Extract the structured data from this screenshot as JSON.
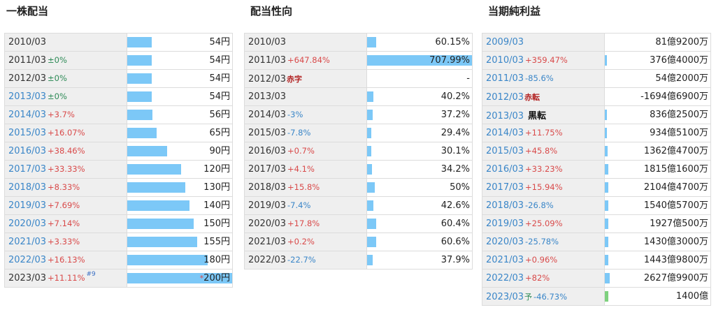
{
  "dividend": {
    "title": "一株配当",
    "rows": [
      {
        "year": "2010/03",
        "change": "",
        "chg_color": "",
        "value": "54円",
        "bar": 0.23,
        "year_blue": false,
        "note": "",
        "star": ""
      },
      {
        "year": "2011/03",
        "change": "±0%",
        "chg_color": "green",
        "value": "54円",
        "bar": 0.23,
        "year_blue": false,
        "note": "",
        "star": ""
      },
      {
        "year": "2012/03",
        "change": "±0%",
        "chg_color": "green",
        "value": "54円",
        "bar": 0.23,
        "year_blue": false,
        "note": "",
        "star": ""
      },
      {
        "year": "2013/03",
        "change": "±0%",
        "chg_color": "green",
        "value": "54円",
        "bar": 0.23,
        "year_blue": true,
        "note": "",
        "star": ""
      },
      {
        "year": "2014/03",
        "change": "+3.7%",
        "chg_color": "red",
        "value": "56円",
        "bar": 0.24,
        "year_blue": true,
        "note": "",
        "star": ""
      },
      {
        "year": "2015/03",
        "change": "+16.07%",
        "chg_color": "red",
        "value": "65円",
        "bar": 0.28,
        "year_blue": true,
        "note": "",
        "star": ""
      },
      {
        "year": "2016/03",
        "change": "+38.46%",
        "chg_color": "red",
        "value": "90円",
        "bar": 0.38,
        "year_blue": true,
        "note": "",
        "star": ""
      },
      {
        "year": "2017/03",
        "change": "+33.33%",
        "chg_color": "red",
        "value": "120円",
        "bar": 0.51,
        "year_blue": true,
        "note": "",
        "star": ""
      },
      {
        "year": "2018/03",
        "change": "+8.33%",
        "chg_color": "red",
        "value": "130円",
        "bar": 0.55,
        "year_blue": true,
        "note": "",
        "star": ""
      },
      {
        "year": "2019/03",
        "change": "+7.69%",
        "chg_color": "red",
        "value": "140円",
        "bar": 0.59,
        "year_blue": true,
        "note": "",
        "star": ""
      },
      {
        "year": "2020/03",
        "change": "+7.14%",
        "chg_color": "red",
        "value": "150円",
        "bar": 0.63,
        "year_blue": true,
        "note": "",
        "star": ""
      },
      {
        "year": "2021/03",
        "change": "+3.33%",
        "chg_color": "red",
        "value": "155円",
        "bar": 0.66,
        "year_blue": true,
        "note": "",
        "star": ""
      },
      {
        "year": "2022/03",
        "change": "+16.13%",
        "chg_color": "red",
        "value": "180円",
        "bar": 0.76,
        "year_blue": true,
        "note": "",
        "star": ""
      },
      {
        "year": "2023/03",
        "change": "+11.11%",
        "chg_color": "red",
        "value": "200円",
        "bar": 1.0,
        "year_blue": false,
        "note": "#9",
        "star": "*"
      }
    ]
  },
  "payout": {
    "title": "配当性向",
    "rows": [
      {
        "year": "2010/03",
        "change": "",
        "chg_color": "",
        "tag": "",
        "tag_color": "",
        "value": "60.15%",
        "bar": 0.085
      },
      {
        "year": "2011/03",
        "change": "+647.84%",
        "chg_color": "red",
        "tag": "",
        "tag_color": "",
        "value": "707.99%",
        "bar": 1.0
      },
      {
        "year": "2012/03",
        "change": "",
        "chg_color": "",
        "tag": "赤字",
        "tag_color": "red",
        "value": "-",
        "bar": 0
      },
      {
        "year": "2013/03",
        "change": "",
        "chg_color": "",
        "tag": "",
        "tag_color": "",
        "value": "40.2%",
        "bar": 0.057
      },
      {
        "year": "2014/03",
        "change": "-3%",
        "chg_color": "blue",
        "tag": "",
        "tag_color": "",
        "value": "37.2%",
        "bar": 0.053
      },
      {
        "year": "2015/03",
        "change": "-7.8%",
        "chg_color": "blue",
        "tag": "",
        "tag_color": "",
        "value": "29.4%",
        "bar": 0.042
      },
      {
        "year": "2016/03",
        "change": "+0.7%",
        "chg_color": "red",
        "tag": "",
        "tag_color": "",
        "value": "30.1%",
        "bar": 0.043
      },
      {
        "year": "2017/03",
        "change": "+4.1%",
        "chg_color": "red",
        "tag": "",
        "tag_color": "",
        "value": "34.2%",
        "bar": 0.048
      },
      {
        "year": "2018/03",
        "change": "+15.8%",
        "chg_color": "red",
        "tag": "",
        "tag_color": "",
        "value": "50%",
        "bar": 0.071
      },
      {
        "year": "2019/03",
        "change": "-7.4%",
        "chg_color": "blue",
        "tag": "",
        "tag_color": "",
        "value": "42.6%",
        "bar": 0.06
      },
      {
        "year": "2020/03",
        "change": "+17.8%",
        "chg_color": "red",
        "tag": "",
        "tag_color": "",
        "value": "60.4%",
        "bar": 0.085
      },
      {
        "year": "2021/03",
        "change": "+0.2%",
        "chg_color": "red",
        "tag": "",
        "tag_color": "",
        "value": "60.6%",
        "bar": 0.086
      },
      {
        "year": "2022/03",
        "change": "-22.7%",
        "chg_color": "blue",
        "tag": "",
        "tag_color": "",
        "value": "37.9%",
        "bar": 0.054
      }
    ]
  },
  "profit": {
    "title": "当期純利益",
    "rows": [
      {
        "year": "2009/03",
        "change": "",
        "chg_color": "",
        "tag": "",
        "tag_color": "",
        "value": "81億9200万",
        "bar": 0,
        "bar_color": "blue"
      },
      {
        "year": "2010/03",
        "change": "+359.47%",
        "chg_color": "red",
        "tag": "",
        "tag_color": "",
        "value": "376億4000万",
        "bar": 0.01,
        "bar_color": "blue"
      },
      {
        "year": "2011/03",
        "change": "-85.6%",
        "chg_color": "blue",
        "tag": "",
        "tag_color": "",
        "value": "54億2000万",
        "bar": 0,
        "bar_color": "blue"
      },
      {
        "year": "2012/03",
        "change": "",
        "chg_color": "",
        "tag": "赤転",
        "tag_color": "red",
        "value": "-1694億6900万",
        "bar": 0,
        "bar_color": "blue"
      },
      {
        "year": "2013/03",
        "change": "",
        "chg_color": "",
        "tag": "黒転",
        "tag_color": "black",
        "value": "836億2500万",
        "bar": 0.02,
        "bar_color": "blue"
      },
      {
        "year": "2014/03",
        "change": "+11.75%",
        "chg_color": "red",
        "tag": "",
        "tag_color": "",
        "value": "934億5100万",
        "bar": 0.02,
        "bar_color": "blue"
      },
      {
        "year": "2015/03",
        "change": "+45.8%",
        "chg_color": "red",
        "tag": "",
        "tag_color": "",
        "value": "1362億4700万",
        "bar": 0.025,
        "bar_color": "blue"
      },
      {
        "year": "2016/03",
        "change": "+33.23%",
        "chg_color": "red",
        "tag": "",
        "tag_color": "",
        "value": "1815億1600万",
        "bar": 0.03,
        "bar_color": "blue"
      },
      {
        "year": "2017/03",
        "change": "+15.94%",
        "chg_color": "red",
        "tag": "",
        "tag_color": "",
        "value": "2104億4700万",
        "bar": 0.035,
        "bar_color": "blue"
      },
      {
        "year": "2018/03",
        "change": "-26.8%",
        "chg_color": "blue",
        "tag": "",
        "tag_color": "",
        "value": "1540億5700万",
        "bar": 0.03,
        "bar_color": "blue"
      },
      {
        "year": "2019/03",
        "change": "+25.09%",
        "chg_color": "red",
        "tag": "",
        "tag_color": "",
        "value": "1927億500万",
        "bar": 0.035,
        "bar_color": "blue"
      },
      {
        "year": "2020/03",
        "change": "-25.78%",
        "chg_color": "blue",
        "tag": "",
        "tag_color": "",
        "value": "1430億3000万",
        "bar": 0.03,
        "bar_color": "blue"
      },
      {
        "year": "2021/03",
        "change": "+0.96%",
        "chg_color": "red",
        "tag": "",
        "tag_color": "",
        "value": "1443億9800万",
        "bar": 0.03,
        "bar_color": "blue"
      },
      {
        "year": "2022/03",
        "change": "+82%",
        "chg_color": "red",
        "tag": "",
        "tag_color": "",
        "value": "2627億9900万",
        "bar": 0.045,
        "bar_color": "blue"
      },
      {
        "year": "2023/03",
        "change": "-46.73%",
        "chg_color": "blue",
        "tag": "予",
        "tag_color": "yo",
        "value": "1400億",
        "bar": 0.03,
        "bar_color": "green"
      }
    ]
  },
  "colors": {
    "bar": "#7cc8f7",
    "bar_forecast": "#7ed17e",
    "increase": "#d94a4a",
    "decrease": "#3a86c8",
    "year_cell": "#efefef"
  }
}
